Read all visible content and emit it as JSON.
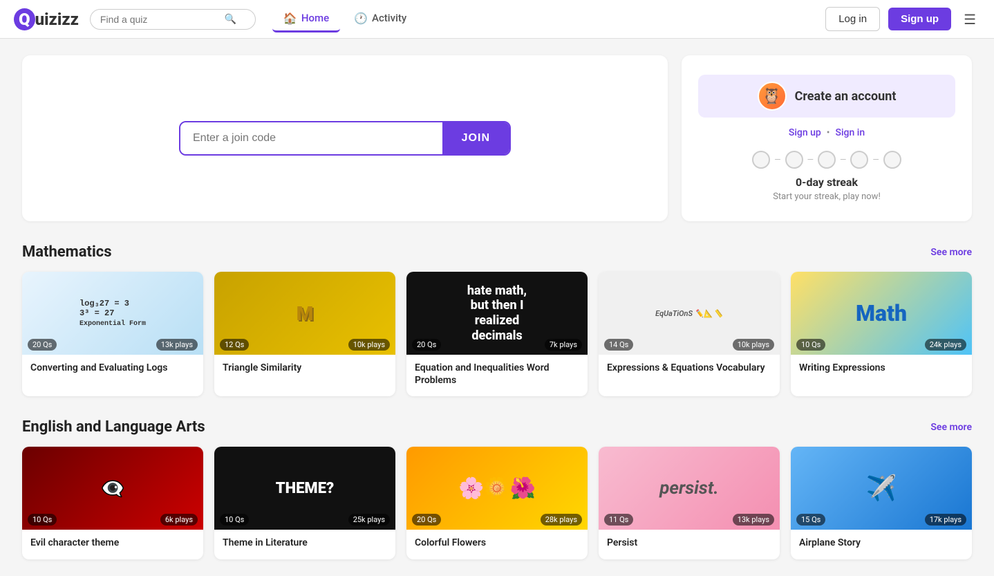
{
  "logo": {
    "q": "Q",
    "text": "uizizz"
  },
  "navbar": {
    "search_placeholder": "Find a quiz",
    "home_label": "Home",
    "activity_label": "Activity",
    "login_label": "Log in",
    "signup_label": "Sign up"
  },
  "hero": {
    "join_placeholder": "Enter a join code",
    "join_button": "JOIN"
  },
  "create_account": {
    "title": "Create an account",
    "signup_label": "Sign up",
    "signin_label": "Sign in",
    "separator": "•",
    "streak_label": "0-day streak",
    "streak_sub": "Start your streak, play now!"
  },
  "math_section": {
    "title": "Mathematics",
    "see_more": "See more",
    "cards": [
      {
        "qs": "20 Qs",
        "plays": "13k plays",
        "title": "Converting and Evaluating Logs",
        "bg": "logs"
      },
      {
        "qs": "12 Qs",
        "plays": "10k plays",
        "title": "Triangle Similarity",
        "bg": "triangle"
      },
      {
        "qs": "20 Qs",
        "plays": "7k plays",
        "title": "Equation and Inequalities Word Problems",
        "bg": "decimals"
      },
      {
        "qs": "14 Qs",
        "plays": "10k plays",
        "title": "Expressions & Equations Vocabulary",
        "bg": "equations"
      },
      {
        "qs": "10 Qs",
        "plays": "24k plays",
        "title": "Writing Expressions",
        "bg": "math-colorful"
      }
    ]
  },
  "ela_section": {
    "title": "English and Language Arts",
    "see_more": "See more",
    "cards": [
      {
        "qs": "10 Qs",
        "plays": "6k plays",
        "title": "Evil character theme",
        "bg": "evil"
      },
      {
        "qs": "10 Qs",
        "plays": "25k plays",
        "title": "Theme in Literature",
        "bg": "theme"
      },
      {
        "qs": "20 Qs",
        "plays": "28k plays",
        "title": "Colorful Flowers",
        "bg": "flowers"
      },
      {
        "qs": "11 Qs",
        "plays": "13k plays",
        "title": "Persist",
        "bg": "persist"
      },
      {
        "qs": "15 Qs",
        "plays": "17k plays",
        "title": "Airplane Story",
        "bg": "plane"
      }
    ]
  }
}
